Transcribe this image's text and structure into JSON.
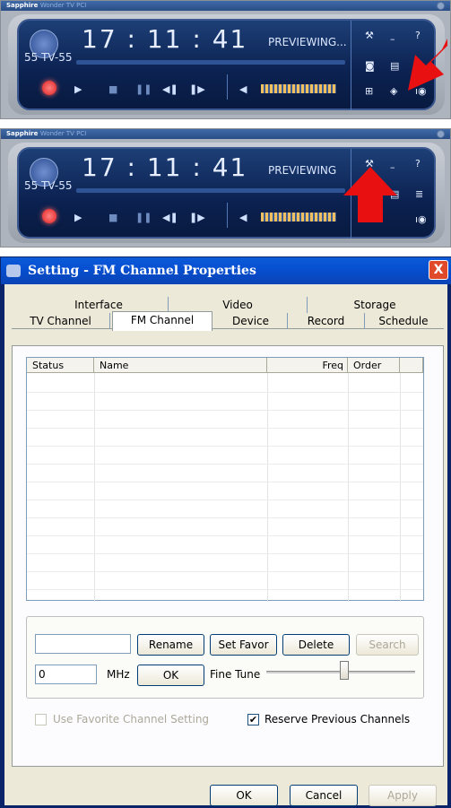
{
  "player": {
    "brand": "Sapphire",
    "brand_product": "Wonder TV PCI",
    "time": "17 : 11 : 41",
    "status": "PREVIEWING...",
    "status_short": "PREVIEWING",
    "channel": "55 TV-55",
    "arrow_color": "#e81010"
  },
  "dialog": {
    "title": "Setting - FM Channel Properties",
    "close_label": "X",
    "tabs_back": [
      "Interface",
      "Video",
      "Storage"
    ],
    "tabs_front": [
      "TV Channel",
      "FM Channel",
      "Device",
      "Record",
      "Schedule"
    ],
    "active_tab": "FM Channel",
    "columns": [
      "Status",
      "Name",
      "Freq",
      "Order"
    ],
    "rows": [],
    "buttons": {
      "rename": "Rename",
      "set_favor": "Set Favor",
      "delete": "Delete",
      "search": "Search",
      "ok_small": "OK",
      "ok": "OK",
      "cancel": "Cancel",
      "apply": "Apply"
    },
    "name_input_value": "",
    "freq_value": "0",
    "mhz_label": "MHz",
    "fine_tune_label": "Fine Tune",
    "use_favorite_label": "Use Favorite Channel Setting",
    "use_favorite_checked": false,
    "reserve_label": "Reserve Previous Channels",
    "reserve_checked": true,
    "fine_tune_level": 0.5
  }
}
